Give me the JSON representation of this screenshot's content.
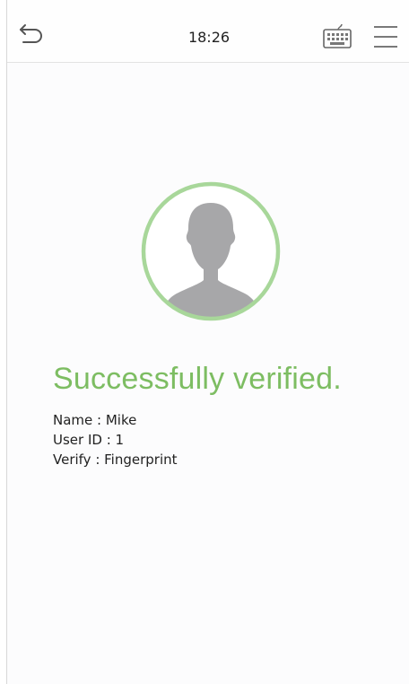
{
  "status_bar": {
    "time": "18:26"
  },
  "icons": {
    "back": "back-arrow-icon",
    "keyboard": "keyboard-icon",
    "menu": "hamburger-menu-icon",
    "avatar": "user-silhouette-icon"
  },
  "result": {
    "message": "Successfully verified.",
    "name_line": "Name : Mike",
    "user_id_line": "User ID : 1",
    "verify_line": "Verify : Fingerprint"
  },
  "colors": {
    "success": "#7dbd62",
    "avatar_ring": "#a8d79a",
    "avatar_silhouette": "#a7a7a9"
  }
}
